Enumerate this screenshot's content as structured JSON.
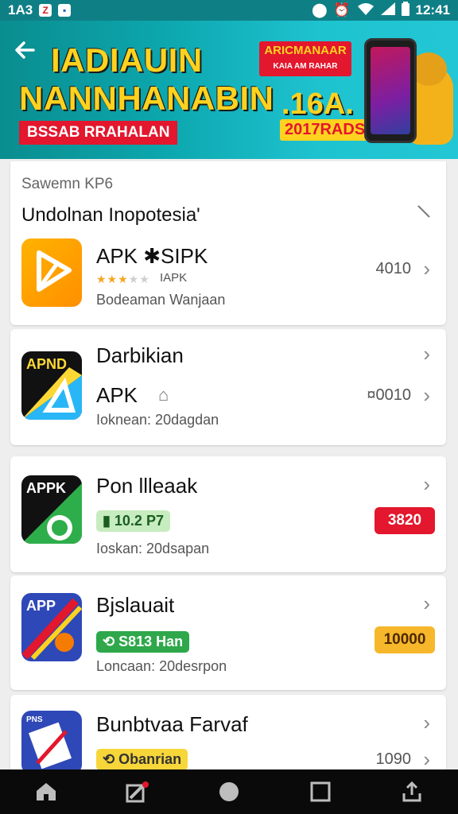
{
  "status_bar": {
    "time_left": "1A3",
    "time_right": "12:41"
  },
  "banner": {
    "title_line1": "IADIAUIN",
    "title_line2": "NANNHANABIN",
    "subtitle": "BSSAB RRAHALAN",
    "promo_box": "ARICMANAAR",
    "promo_box_sub": "KAIA AM RAHAR",
    "promo_big": ".16A.",
    "promo_small": "2017RADS"
  },
  "section": {
    "label": "Sawemn KP6",
    "title": "Undolnan Inopotesia'"
  },
  "apps": [
    {
      "name": "APK ✱SIPK",
      "rating_text": "IAPK",
      "rating": 3,
      "sub": "Bodeaman Wanjaan",
      "number": "4010",
      "icon_text": ""
    },
    {
      "name": "Darbikian",
      "name2": "APK",
      "sub": "Ioknean: 20dagdan",
      "number": "¤0010",
      "icon_text": "APND"
    },
    {
      "name": "Pon llleaak",
      "badge": "10.2 P7",
      "sub": "Ioskan: 20dsapan",
      "price": "3820",
      "icon_text": "APPK"
    },
    {
      "name": "Bjslauait",
      "badge": "S813 Han",
      "sub": "Loncaan: 20desrpon",
      "price": "10000",
      "icon_text": "APP"
    },
    {
      "name": "Bunbtvaa Farvaf",
      "badge": "Obanrian",
      "number": "1090",
      "icon_text": "PNS"
    }
  ],
  "colors": {
    "status_bar": "#0f7f86",
    "banner_yellow": "#ffd21f",
    "banner_red": "#e3172d",
    "star": "#f5a623"
  }
}
